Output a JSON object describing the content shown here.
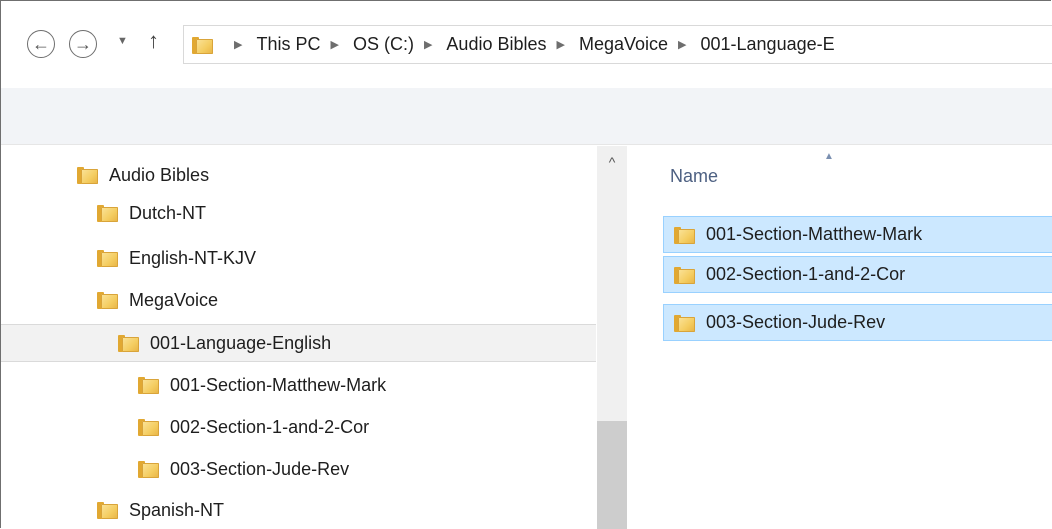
{
  "address_bar": {
    "breadcrumbs": [
      "This PC",
      "OS (C:)",
      "Audio Bibles",
      "MegaVoice",
      "001-Language-E"
    ]
  },
  "nav": {
    "back_icon": "back-arrow-icon",
    "forward_icon": "forward-arrow-icon",
    "recent_icon": "chevron-down-icon",
    "up_icon": "up-arrow-icon"
  },
  "tree": {
    "items": [
      {
        "label": "Audio Bibles"
      },
      {
        "label": "Dutch-NT"
      },
      {
        "label": "English-NT-KJV"
      },
      {
        "label": "MegaVoice"
      },
      {
        "label": "001-Language-English",
        "selected": true
      },
      {
        "label": "001-Section-Matthew-Mark"
      },
      {
        "label": "002-Section-1-and-2-Cor"
      },
      {
        "label": "003-Section-Jude-Rev"
      },
      {
        "label": "Spanish-NT"
      }
    ]
  },
  "file_list": {
    "column_name": "Name",
    "rows": [
      {
        "name": "001-Section-Matthew-Mark"
      },
      {
        "name": "002-Section-1-and-2-Cor"
      },
      {
        "name": "003-Section-Jude-Rev"
      }
    ]
  },
  "colors": {
    "selection_bg": "#cce8ff",
    "selection_border": "#99d1ff",
    "folder": "#f4cc5f"
  }
}
